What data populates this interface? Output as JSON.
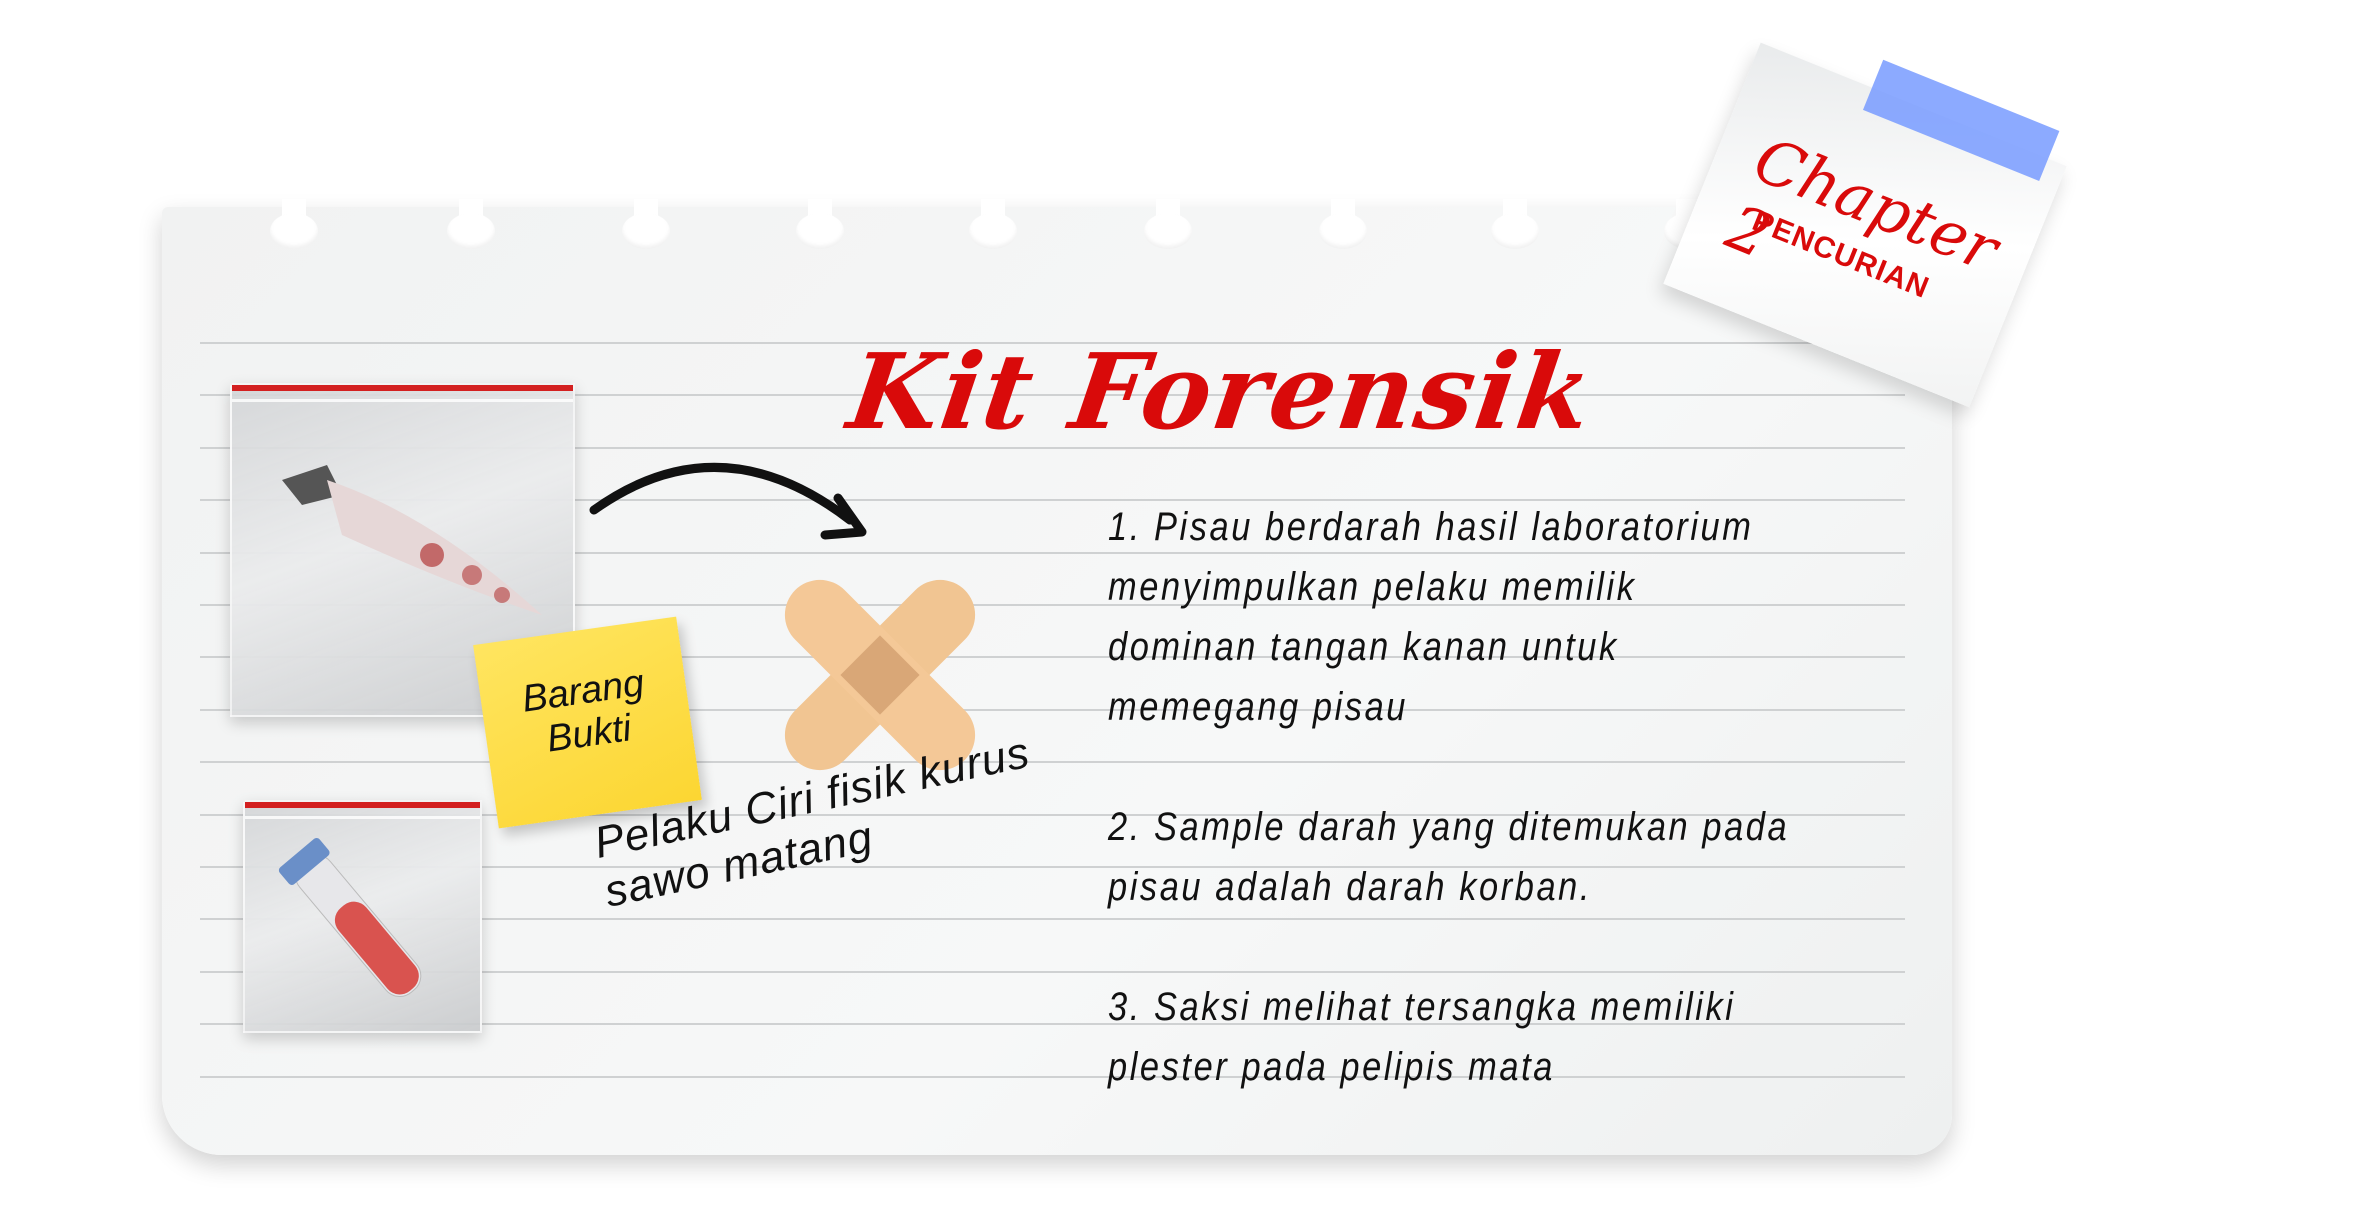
{
  "title": "Kit Forensik",
  "chapter": {
    "label": "Chapter 2",
    "subtitle": "PENCURIAN",
    "tape_color": "#7f9bff"
  },
  "sticky_note": {
    "line1": "Barang",
    "line2": "Bukti"
  },
  "hand_note": {
    "line1": "Pelaku Ciri fisik kurus",
    "line2": "sawo matang"
  },
  "notes": [
    "1. Pisau berdarah hasil laboratorium",
    "menyimpulkan pelaku memilik",
    "dominan tangan kanan untuk",
    "memegang pisau",
    "2. Sample darah yang ditemukan pada",
    "pisau adalah darah korban.",
    "3. Saksi melihat tersangka memiliki",
    "plester pada pelipis mata"
  ],
  "colors": {
    "accent": "#d90a0a",
    "sticky": "#fcd632",
    "bandage": "#f1c592"
  },
  "icons": [
    "knife-evidence-bag",
    "blood-tube-evidence-bag",
    "arrow-icon",
    "bandage-icon"
  ]
}
